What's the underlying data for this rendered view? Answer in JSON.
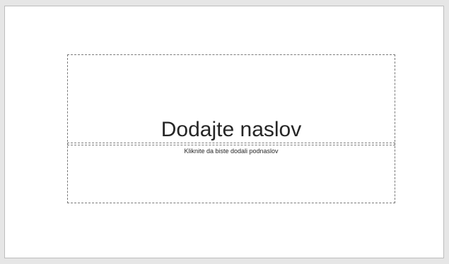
{
  "slide": {
    "title_placeholder": "Dodajte naslov",
    "subtitle_placeholder": "Kliknite da biste dodali podnaslov"
  }
}
